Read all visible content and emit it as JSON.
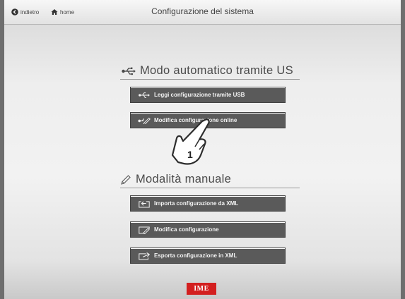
{
  "header": {
    "back_label": "indietro",
    "home_label": "home",
    "title": "Configurazione del sistema"
  },
  "auto_section": {
    "heading": "Modo automatico tramite US",
    "buttons": [
      {
        "label": "Leggi configurazione tramite USB",
        "icon": "usb-icon"
      },
      {
        "label": "Modifica configurazione online",
        "icon": "usb-pencil-icon"
      }
    ]
  },
  "manual_section": {
    "heading": "Modalità manuale",
    "buttons": [
      {
        "label": "Importa configurazione da XML",
        "icon": "import-icon"
      },
      {
        "label": "Modifica configurazione",
        "icon": "edit-icon"
      },
      {
        "label": "Esporta configurazione in XML",
        "icon": "export-icon"
      }
    ]
  },
  "callout": {
    "number": "1"
  },
  "logo": {
    "text": "IME"
  },
  "colors": {
    "button_bg": "#5a5a5a",
    "logo_red": "#d31f1f",
    "background_light": "#efefef"
  }
}
